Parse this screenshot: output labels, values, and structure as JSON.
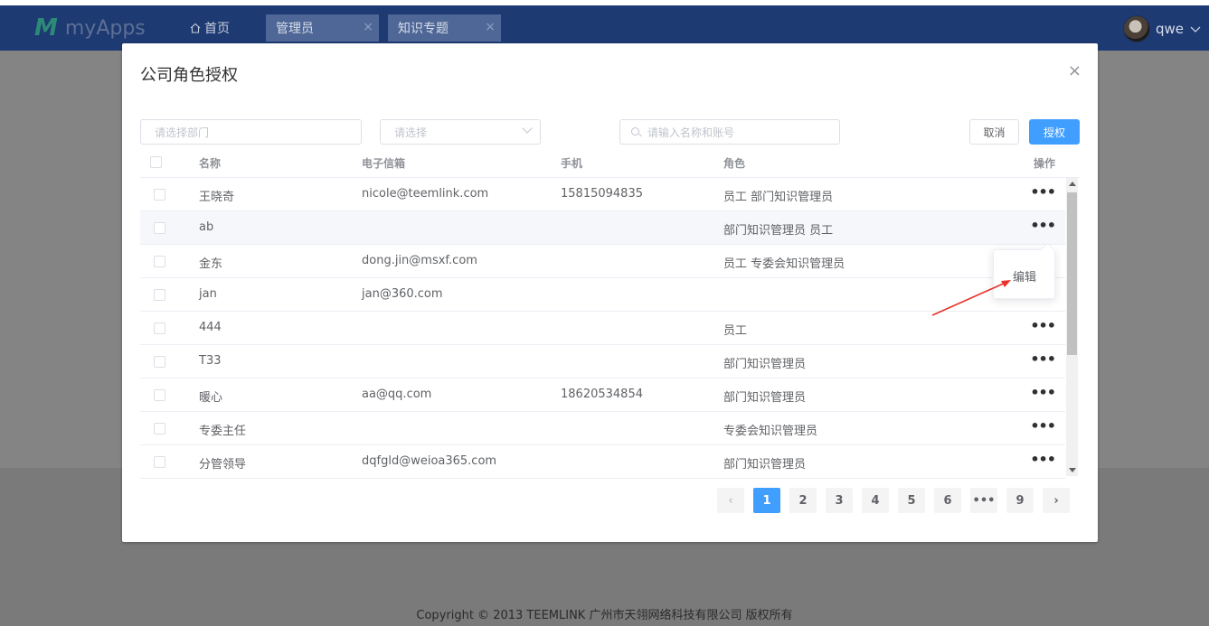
{
  "app": {
    "logo_mark": "M",
    "logo_text": "myApps"
  },
  "nav": {
    "home_icon": "home-icon",
    "home_label": "首页",
    "tabs": [
      {
        "label": "管理员",
        "close": "×"
      },
      {
        "label": "知识专题",
        "close": "×"
      }
    ]
  },
  "user": {
    "name": "qwe",
    "menu_icon": "chevron-down-icon"
  },
  "dialog": {
    "title": "公司角色授权",
    "close": "×",
    "dept_placeholder": "请选择部门",
    "select_placeholder": "请选择",
    "search_placeholder": "请输入名称和账号",
    "cancel_label": "取消",
    "authorize_label": "授权"
  },
  "table": {
    "headers": {
      "name": "名称",
      "email": "电子信箱",
      "phone": "手机",
      "role": "角色",
      "action": "操作"
    },
    "more": "•••",
    "rows": [
      {
        "name": "王晓奇",
        "email": "nicole@teemlink.com",
        "phone": "15815094835",
        "role": "员工  部门知识管理员"
      },
      {
        "name": "ab",
        "email": "",
        "phone": "",
        "role": "部门知识管理员  员工"
      },
      {
        "name": "金东",
        "email": "dong.jin@msxf.com",
        "phone": "",
        "role": "员工  专委会知识管理员"
      },
      {
        "name": "jan",
        "email": "jan@360.com",
        "phone": "",
        "role": ""
      },
      {
        "name": "444",
        "email": "",
        "phone": "",
        "role": "员工"
      },
      {
        "name": "T33",
        "email": "",
        "phone": "",
        "role": "部门知识管理员"
      },
      {
        "name": "暖心",
        "email": "aa@qq.com",
        "phone": "18620534854",
        "role": "部门知识管理员"
      },
      {
        "name": "专委主任",
        "email": "",
        "phone": "",
        "role": "专委会知识管理员"
      },
      {
        "name": "分管领导",
        "email": "dqfgld@weioa365.com",
        "phone": "",
        "role": "部门知识管理员"
      }
    ]
  },
  "popover": {
    "edit_label": "编辑"
  },
  "pagination": {
    "prev": "‹",
    "pages": [
      "1",
      "2",
      "3",
      "4",
      "5",
      "6",
      "•••",
      "9"
    ],
    "current": "1",
    "next": "›"
  },
  "footer": {
    "copyright": "Copyright © 2013 TEEMLINK 广州市天翎网络科技有限公司 版权所有"
  },
  "colors": {
    "header": "#1e3a73",
    "primary": "#409eff",
    "arrow": "#e8332b"
  }
}
